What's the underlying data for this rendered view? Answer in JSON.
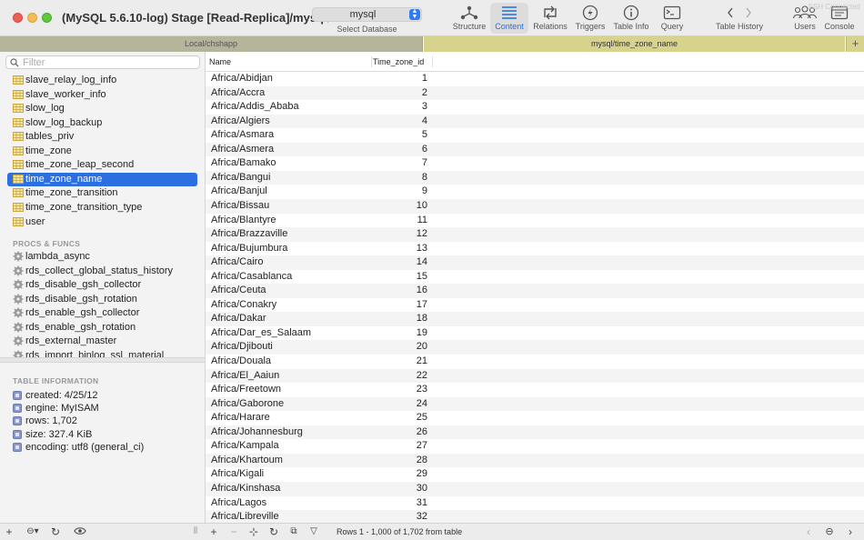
{
  "window": {
    "title": "(MySQL 5.6.10-log) Stage [Read-Replica]/mysql/...",
    "ssh_status": "SSH Connected"
  },
  "database_select": {
    "value": "mysql",
    "caption": "Select Database"
  },
  "toolbar": {
    "buttons": [
      {
        "label": "Structure",
        "icon": "structure-icon"
      },
      {
        "label": "Content",
        "icon": "content-icon",
        "active": true
      },
      {
        "label": "Relations",
        "icon": "relations-icon"
      },
      {
        "label": "Triggers",
        "icon": "triggers-icon"
      },
      {
        "label": "Table Info",
        "icon": "info-icon"
      },
      {
        "label": "Query",
        "icon": "query-icon"
      },
      {
        "label": "Table History",
        "icon": "history-arrows-icon"
      },
      {
        "label": "Users",
        "icon": "users-icon"
      },
      {
        "label": "Console",
        "icon": "console-icon"
      }
    ]
  },
  "tabs": [
    {
      "label": "Local/chshapp"
    },
    {
      "label": "mysql/time_zone_name",
      "active": true
    }
  ],
  "sidebar": {
    "filter_placeholder": "Filter",
    "tables": [
      "slave_relay_log_info",
      "slave_worker_info",
      "slow_log",
      "slow_log_backup",
      "tables_priv",
      "time_zone",
      "time_zone_leap_second",
      "time_zone_name",
      "time_zone_transition",
      "time_zone_transition_type",
      "user"
    ],
    "selected_table": "time_zone_name",
    "procs_header": "PROCS & FUNCS",
    "procs": [
      "lambda_async",
      "rds_collect_global_status_history",
      "rds_disable_gsh_collector",
      "rds_disable_gsh_rotation",
      "rds_enable_gsh_collector",
      "rds_enable_gsh_rotation",
      "rds_external_master",
      "rds_import_binlog_ssl_material"
    ],
    "table_info_header": "TABLE INFORMATION",
    "table_info": [
      "created: 4/25/12",
      "engine: MyISAM",
      "rows: 1,702",
      "size: 327.4 KiB",
      "encoding: utf8 (general_ci)"
    ]
  },
  "grid": {
    "columns": [
      "Name",
      "Time_zone_id"
    ],
    "rows": [
      [
        "Africa/Abidjan",
        "1"
      ],
      [
        "Africa/Accra",
        "2"
      ],
      [
        "Africa/Addis_Ababa",
        "3"
      ],
      [
        "Africa/Algiers",
        "4"
      ],
      [
        "Africa/Asmara",
        "5"
      ],
      [
        "Africa/Asmera",
        "6"
      ],
      [
        "Africa/Bamako",
        "7"
      ],
      [
        "Africa/Bangui",
        "8"
      ],
      [
        "Africa/Banjul",
        "9"
      ],
      [
        "Africa/Bissau",
        "10"
      ],
      [
        "Africa/Blantyre",
        "11"
      ],
      [
        "Africa/Brazzaville",
        "12"
      ],
      [
        "Africa/Bujumbura",
        "13"
      ],
      [
        "Africa/Cairo",
        "14"
      ],
      [
        "Africa/Casablanca",
        "15"
      ],
      [
        "Africa/Ceuta",
        "16"
      ],
      [
        "Africa/Conakry",
        "17"
      ],
      [
        "Africa/Dakar",
        "18"
      ],
      [
        "Africa/Dar_es_Salaam",
        "19"
      ],
      [
        "Africa/Djibouti",
        "20"
      ],
      [
        "Africa/Douala",
        "21"
      ],
      [
        "Africa/El_Aaiun",
        "22"
      ],
      [
        "Africa/Freetown",
        "23"
      ],
      [
        "Africa/Gaborone",
        "24"
      ],
      [
        "Africa/Harare",
        "25"
      ],
      [
        "Africa/Johannesburg",
        "26"
      ],
      [
        "Africa/Kampala",
        "27"
      ],
      [
        "Africa/Khartoum",
        "28"
      ],
      [
        "Africa/Kigali",
        "29"
      ],
      [
        "Africa/Kinshasa",
        "30"
      ],
      [
        "Africa/Lagos",
        "31"
      ],
      [
        "Africa/Libreville",
        "32"
      ]
    ]
  },
  "status": {
    "rows_text": "Rows 1 - 1,000 of 1,702 from table"
  },
  "colors": {
    "accent": "#2b6fe0",
    "tab_inactive": "#b4b59a",
    "tab_active": "#d7d38c"
  }
}
